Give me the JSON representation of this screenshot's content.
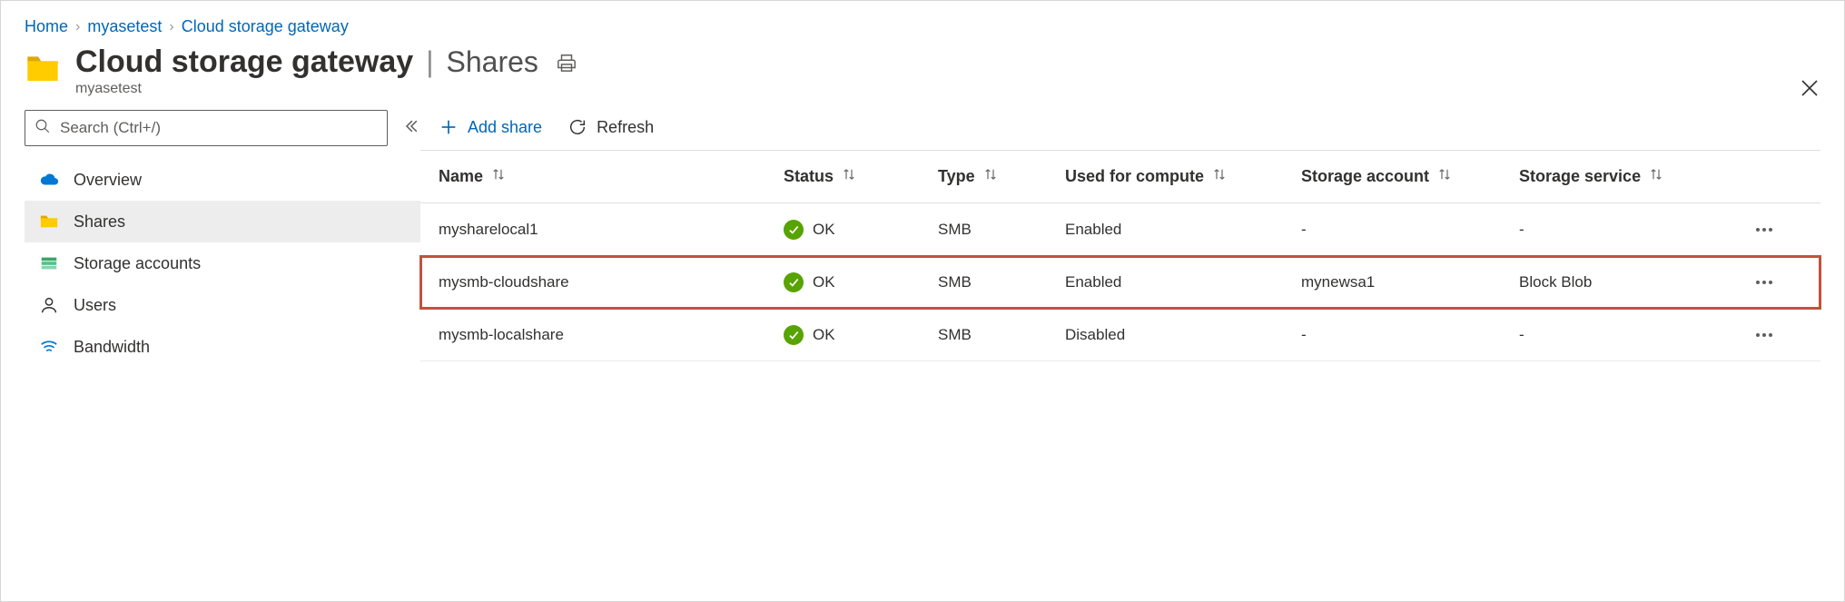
{
  "breadcrumb": {
    "items": [
      {
        "label": "Home"
      },
      {
        "label": "myasetest"
      },
      {
        "label": "Cloud storage gateway"
      }
    ]
  },
  "header": {
    "title": "Cloud storage gateway",
    "section": "Shares",
    "subtitle": "myasetest"
  },
  "search": {
    "placeholder": "Search (Ctrl+/)"
  },
  "sidebar": {
    "items": [
      {
        "label": "Overview",
        "icon": "cloud"
      },
      {
        "label": "Shares",
        "icon": "folder",
        "active": true
      },
      {
        "label": "Storage accounts",
        "icon": "storage"
      },
      {
        "label": "Users",
        "icon": "user"
      },
      {
        "label": "Bandwidth",
        "icon": "bandwidth"
      }
    ]
  },
  "toolbar": {
    "add": "Add share",
    "refresh": "Refresh"
  },
  "table": {
    "columns": {
      "name": "Name",
      "status": "Status",
      "type": "Type",
      "compute": "Used for compute",
      "account": "Storage account",
      "service": "Storage service"
    },
    "rows": [
      {
        "name": "mysharelocal1",
        "status": "OK",
        "type": "SMB",
        "compute": "Enabled",
        "account": "-",
        "service": "-"
      },
      {
        "name": "mysmb-cloudshare",
        "status": "OK",
        "type": "SMB",
        "compute": "Enabled",
        "account": "mynewsa1",
        "service": "Block Blob",
        "highlight": true
      },
      {
        "name": "mysmb-localshare",
        "status": "OK",
        "type": "SMB",
        "compute": "Disabled",
        "account": "-",
        "service": "-"
      }
    ]
  }
}
